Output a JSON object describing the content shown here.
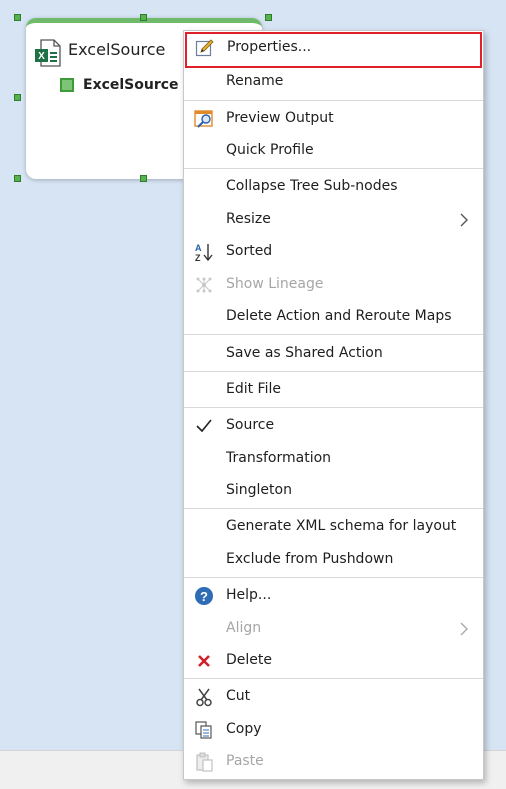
{
  "node": {
    "title": "ExcelSource",
    "subnode": "ExcelSource",
    "accent_color": "#6fbb6b",
    "icon": "excel-file-icon"
  },
  "menu": {
    "highlight_color": "#e0202a",
    "items": [
      {
        "label": "Properties...",
        "icon": "pencil-edit-icon",
        "highlighted": true
      },
      {
        "label": "Rename"
      },
      {
        "label": "Preview Output",
        "icon": "preview-output-icon"
      },
      {
        "label": "Quick Profile"
      },
      {
        "label": "Collapse Tree Sub-nodes"
      },
      {
        "label": "Resize",
        "submenu": true
      },
      {
        "label": "Sorted",
        "icon": "sort-az-icon"
      },
      {
        "label": "Show Lineage",
        "icon": "lineage-icon",
        "disabled": true
      },
      {
        "label": "Delete Action and Reroute Maps"
      },
      {
        "label": "Save as Shared Action"
      },
      {
        "label": "Edit File"
      },
      {
        "label": "Source",
        "icon": "checkmark-icon",
        "checked": true
      },
      {
        "label": "Transformation"
      },
      {
        "label": "Singleton"
      },
      {
        "label": "Generate XML schema for layout"
      },
      {
        "label": "Exclude from Pushdown"
      },
      {
        "label": "Help...",
        "icon": "help-icon"
      },
      {
        "label": "Align",
        "submenu": true,
        "disabled": true
      },
      {
        "label": "Delete",
        "icon": "delete-x-icon"
      },
      {
        "label": "Cut",
        "icon": "scissors-icon"
      },
      {
        "label": "Copy",
        "icon": "copy-icon"
      },
      {
        "label": "Paste",
        "icon": "paste-icon",
        "disabled": true
      }
    ]
  }
}
